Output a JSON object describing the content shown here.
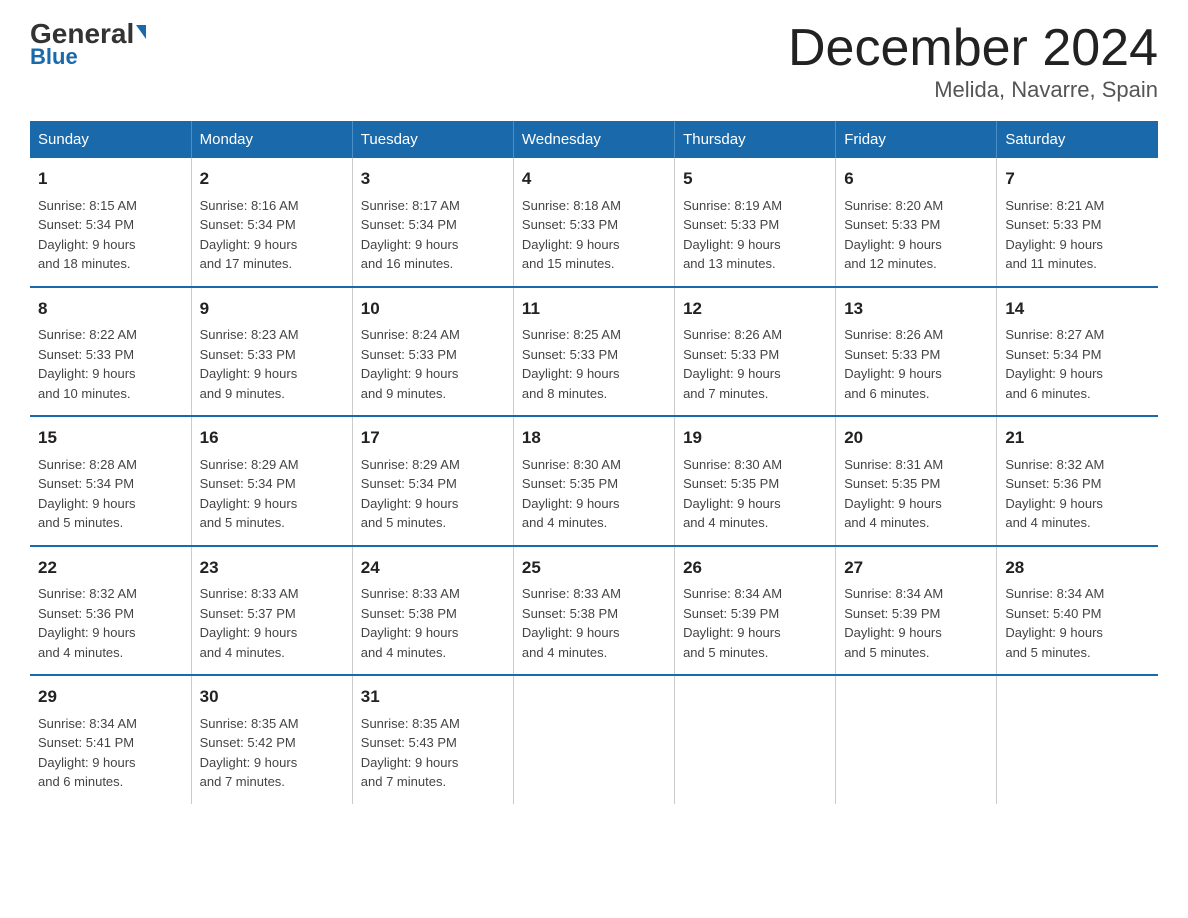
{
  "header": {
    "logo_general": "General",
    "logo_blue": "Blue",
    "title": "December 2024",
    "subtitle": "Melida, Navarre, Spain"
  },
  "days_of_week": [
    "Sunday",
    "Monday",
    "Tuesday",
    "Wednesday",
    "Thursday",
    "Friday",
    "Saturday"
  ],
  "weeks": [
    [
      {
        "day": "1",
        "sunrise": "8:15 AM",
        "sunset": "5:34 PM",
        "daylight": "9 hours and 18 minutes."
      },
      {
        "day": "2",
        "sunrise": "8:16 AM",
        "sunset": "5:34 PM",
        "daylight": "9 hours and 17 minutes."
      },
      {
        "day": "3",
        "sunrise": "8:17 AM",
        "sunset": "5:34 PM",
        "daylight": "9 hours and 16 minutes."
      },
      {
        "day": "4",
        "sunrise": "8:18 AM",
        "sunset": "5:33 PM",
        "daylight": "9 hours and 15 minutes."
      },
      {
        "day": "5",
        "sunrise": "8:19 AM",
        "sunset": "5:33 PM",
        "daylight": "9 hours and 13 minutes."
      },
      {
        "day": "6",
        "sunrise": "8:20 AM",
        "sunset": "5:33 PM",
        "daylight": "9 hours and 12 minutes."
      },
      {
        "day": "7",
        "sunrise": "8:21 AM",
        "sunset": "5:33 PM",
        "daylight": "9 hours and 11 minutes."
      }
    ],
    [
      {
        "day": "8",
        "sunrise": "8:22 AM",
        "sunset": "5:33 PM",
        "daylight": "9 hours and 10 minutes."
      },
      {
        "day": "9",
        "sunrise": "8:23 AM",
        "sunset": "5:33 PM",
        "daylight": "9 hours and 9 minutes."
      },
      {
        "day": "10",
        "sunrise": "8:24 AM",
        "sunset": "5:33 PM",
        "daylight": "9 hours and 9 minutes."
      },
      {
        "day": "11",
        "sunrise": "8:25 AM",
        "sunset": "5:33 PM",
        "daylight": "9 hours and 8 minutes."
      },
      {
        "day": "12",
        "sunrise": "8:26 AM",
        "sunset": "5:33 PM",
        "daylight": "9 hours and 7 minutes."
      },
      {
        "day": "13",
        "sunrise": "8:26 AM",
        "sunset": "5:33 PM",
        "daylight": "9 hours and 6 minutes."
      },
      {
        "day": "14",
        "sunrise": "8:27 AM",
        "sunset": "5:34 PM",
        "daylight": "9 hours and 6 minutes."
      }
    ],
    [
      {
        "day": "15",
        "sunrise": "8:28 AM",
        "sunset": "5:34 PM",
        "daylight": "9 hours and 5 minutes."
      },
      {
        "day": "16",
        "sunrise": "8:29 AM",
        "sunset": "5:34 PM",
        "daylight": "9 hours and 5 minutes."
      },
      {
        "day": "17",
        "sunrise": "8:29 AM",
        "sunset": "5:34 PM",
        "daylight": "9 hours and 5 minutes."
      },
      {
        "day": "18",
        "sunrise": "8:30 AM",
        "sunset": "5:35 PM",
        "daylight": "9 hours and 4 minutes."
      },
      {
        "day": "19",
        "sunrise": "8:30 AM",
        "sunset": "5:35 PM",
        "daylight": "9 hours and 4 minutes."
      },
      {
        "day": "20",
        "sunrise": "8:31 AM",
        "sunset": "5:35 PM",
        "daylight": "9 hours and 4 minutes."
      },
      {
        "day": "21",
        "sunrise": "8:32 AM",
        "sunset": "5:36 PM",
        "daylight": "9 hours and 4 minutes."
      }
    ],
    [
      {
        "day": "22",
        "sunrise": "8:32 AM",
        "sunset": "5:36 PM",
        "daylight": "9 hours and 4 minutes."
      },
      {
        "day": "23",
        "sunrise": "8:33 AM",
        "sunset": "5:37 PM",
        "daylight": "9 hours and 4 minutes."
      },
      {
        "day": "24",
        "sunrise": "8:33 AM",
        "sunset": "5:38 PM",
        "daylight": "9 hours and 4 minutes."
      },
      {
        "day": "25",
        "sunrise": "8:33 AM",
        "sunset": "5:38 PM",
        "daylight": "9 hours and 4 minutes."
      },
      {
        "day": "26",
        "sunrise": "8:34 AM",
        "sunset": "5:39 PM",
        "daylight": "9 hours and 5 minutes."
      },
      {
        "day": "27",
        "sunrise": "8:34 AM",
        "sunset": "5:39 PM",
        "daylight": "9 hours and 5 minutes."
      },
      {
        "day": "28",
        "sunrise": "8:34 AM",
        "sunset": "5:40 PM",
        "daylight": "9 hours and 5 minutes."
      }
    ],
    [
      {
        "day": "29",
        "sunrise": "8:34 AM",
        "sunset": "5:41 PM",
        "daylight": "9 hours and 6 minutes."
      },
      {
        "day": "30",
        "sunrise": "8:35 AM",
        "sunset": "5:42 PM",
        "daylight": "9 hours and 7 minutes."
      },
      {
        "day": "31",
        "sunrise": "8:35 AM",
        "sunset": "5:43 PM",
        "daylight": "9 hours and 7 minutes."
      },
      null,
      null,
      null,
      null
    ]
  ]
}
